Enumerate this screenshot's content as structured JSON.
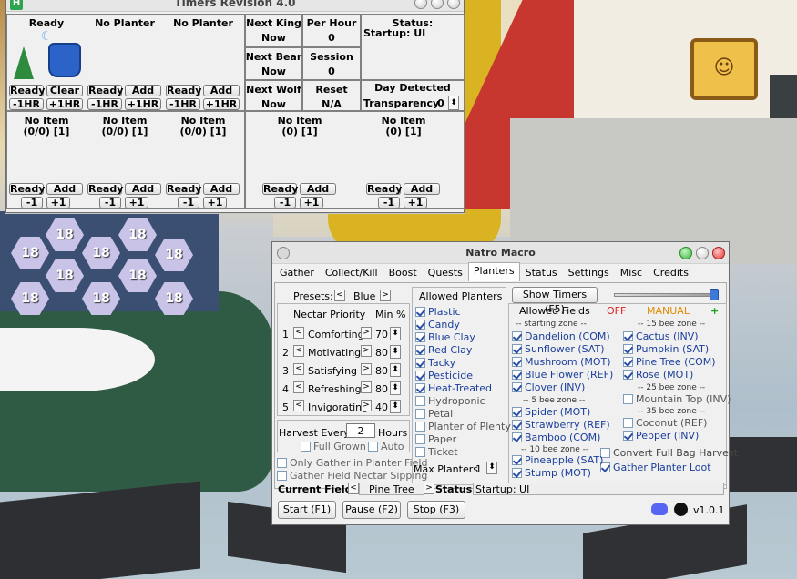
{
  "timers": {
    "title": "Timers Revision 4.0",
    "icon": "H",
    "planters": [
      {
        "status": "Ready",
        "b1": "Ready",
        "b2": "Clear",
        "m": "-1HR",
        "p": "+1HR"
      },
      {
        "status": "No Planter",
        "b1": "Ready",
        "b2": "Add",
        "m": "-1HR",
        "p": "+1HR"
      },
      {
        "status": "No Planter",
        "b1": "Ready",
        "b2": "Add",
        "m": "-1HR",
        "p": "+1HR"
      }
    ],
    "next_king_label": "Next King",
    "next_king_val": "Now",
    "per_hour_label": "Per Hour",
    "per_hour_val": "0",
    "next_bear_label": "Next Bear",
    "next_bear_val": "Now",
    "session_label": "Session",
    "session_val": "0",
    "next_wolf_label": "Next Wolf",
    "next_wolf_val": "Now",
    "reset_label": "Reset",
    "reset_val": "N/A",
    "status_label": "Status:",
    "status_val": "Startup: UI",
    "day_detected": "Day Detected",
    "transparency_label": "Transparency",
    "transparency_val": "0",
    "items_left": [
      {
        "name": "No Item",
        "count": "(0/0) [1]",
        "b1": "Ready",
        "b2": "Add",
        "m": "-1",
        "p": "+1"
      },
      {
        "name": "No Item",
        "count": "(0/0) [1]",
        "b1": "Ready",
        "b2": "Add",
        "m": "-1",
        "p": "+1"
      },
      {
        "name": "No Item",
        "count": "(0/0) [1]",
        "b1": "Ready",
        "b2": "Add",
        "m": "-1",
        "p": "+1"
      }
    ],
    "items_right": [
      {
        "name": "No Item",
        "count": "(0) [1]",
        "b1": "Ready",
        "b2": "Add",
        "m": "-1",
        "p": "+1"
      },
      {
        "name": "No Item",
        "count": "(0) [1]",
        "b1": "Ready",
        "b2": "Add",
        "m": "-1",
        "p": "+1"
      }
    ]
  },
  "game": {
    "hive_number": "18"
  },
  "natro": {
    "title": "Natro Macro",
    "tabs": [
      "Gather",
      "Collect/Kill",
      "Boost",
      "Quests",
      "Planters",
      "Status",
      "Settings",
      "Misc",
      "Credits"
    ],
    "active_tab": "Planters",
    "presets_label": "Presets:",
    "presets_val": "Blue",
    "nectar_priority": "Nectar Priority",
    "min_pct": "Min %",
    "nectars": [
      {
        "n": "1",
        "name": "Comforting",
        "val": "70"
      },
      {
        "n": "2",
        "name": "Motivating",
        "val": "80"
      },
      {
        "n": "3",
        "name": "Satisfying",
        "val": "80"
      },
      {
        "n": "4",
        "name": "Refreshing",
        "val": "80"
      },
      {
        "n": "5",
        "name": "Invigorating",
        "val": "40"
      }
    ],
    "harvest_every": "Harvest Every",
    "harvest_val": "2",
    "hours": "Hours",
    "full_grown": "Full Grown",
    "auto": "Auto",
    "only_gather": "Only Gather in Planter Field",
    "gather_nectar": "Gather Field Nectar Sipping",
    "allowed_planters": "Allowed Planters",
    "planters": [
      {
        "name": "Plastic",
        "on": true
      },
      {
        "name": "Candy",
        "on": true
      },
      {
        "name": "Blue Clay",
        "on": true
      },
      {
        "name": "Red Clay",
        "on": true
      },
      {
        "name": "Tacky",
        "on": true
      },
      {
        "name": "Pesticide",
        "on": true
      },
      {
        "name": "Heat-Treated",
        "on": true
      },
      {
        "name": "Hydroponic",
        "on": false
      },
      {
        "name": "Petal",
        "on": false
      },
      {
        "name": "Planter of Plenty",
        "on": false
      },
      {
        "name": "Paper",
        "on": false
      },
      {
        "name": "Ticket",
        "on": false
      }
    ],
    "max_planters_label": "Max Planters",
    "max_planters_val": "1",
    "show_timers": "Show Timers (F5)",
    "allowed_fields": "Allowed Fields",
    "off": "OFF",
    "manual": "MANUAL",
    "plus": "+",
    "zone_start": "-- starting zone --",
    "zone5": "-- 5 bee zone --",
    "zone10": "-- 10 bee zone --",
    "zone15": "-- 15 bee zone --",
    "zone25": "-- 25 bee zone --",
    "zone35": "-- 35 bee zone --",
    "fields_start": [
      "Dandelion (COM)",
      "Sunflower (SAT)",
      "Mushroom (MOT)",
      "Blue Flower (REF)",
      "Clover (INV)"
    ],
    "fields_5": [
      "Spider (MOT)",
      "Strawberry (REF)",
      "Bamboo (COM)"
    ],
    "fields_10": [
      "Pineapple (SAT)",
      "Stump (MOT)"
    ],
    "fields_15": [
      "Cactus (INV)",
      "Pumpkin (SAT)",
      "Pine Tree (COM)",
      "Rose (MOT)"
    ],
    "fields_25": [
      "Mountain Top (INV)"
    ],
    "fields_35": [
      "Coconut (REF)",
      "Pepper (INV)"
    ],
    "convert_full": "Convert Full Bag Harvest",
    "gather_loot": "Gather Planter Loot",
    "current_field_label": "Current Field:",
    "current_field_val": "Pine Tree",
    "status_label": "Status:",
    "status_val": "Startup: UI",
    "start": "Start (F1)",
    "pause": "Pause (F2)",
    "stop": "Stop (F3)",
    "version": "v1.0.1",
    "colors": {
      "off": "#e02020",
      "manual": "#e08a00",
      "plus": "#1aa31a",
      "field_text": "#1a3e9b"
    }
  }
}
